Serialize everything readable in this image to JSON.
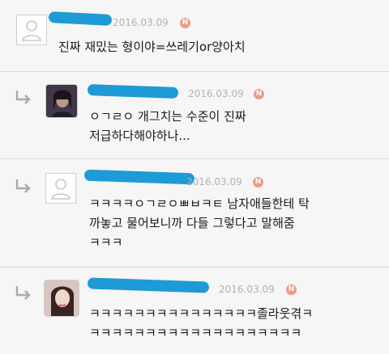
{
  "colors": {
    "background": "#f6f6f6",
    "redaction": "#1e9ad6",
    "badge": "#f09a86",
    "meta": "#b2b2b2"
  },
  "comments": [
    {
      "date": "2016.03.09",
      "badge": "N",
      "lines": [
        "진짜 재밌는 형이야=쓰레기or양아치"
      ],
      "avatar": "default-avatar-icon"
    },
    {
      "date": "2016.03.09",
      "badge": "N",
      "lines": [
        "ㅇㄱㄹㅇ 개그치는 수준이 진짜",
        "저급하다해야하나..."
      ],
      "avatar": "profile-photo"
    },
    {
      "date": "2016.03.09",
      "badge": "N",
      "lines": [
        "ㅋㅋㅋㅋㅇㄱㄹㅇㅃㅂㅋㅌ 남자애들한테 탁",
        "까놓고 물어보니까 다들 그렇다고 말해줌",
        "ㅋㅋㅋ"
      ],
      "avatar": "default-avatar-icon"
    },
    {
      "date": "2016.03.09",
      "badge": "N",
      "lines": [
        "ㅋㅋㅋㅋㅋㅋㅋㅋㅋㅋㅋㅋㅋㅋㅋ졸라웃겪ㅋ",
        "ㅋㅋㅋㅋㅋㅋㅋㅋㅋㅋㅋㅋㅋㅋㅋㅋㅋㅋㅋ"
      ],
      "avatar": "profile-photo"
    }
  ]
}
